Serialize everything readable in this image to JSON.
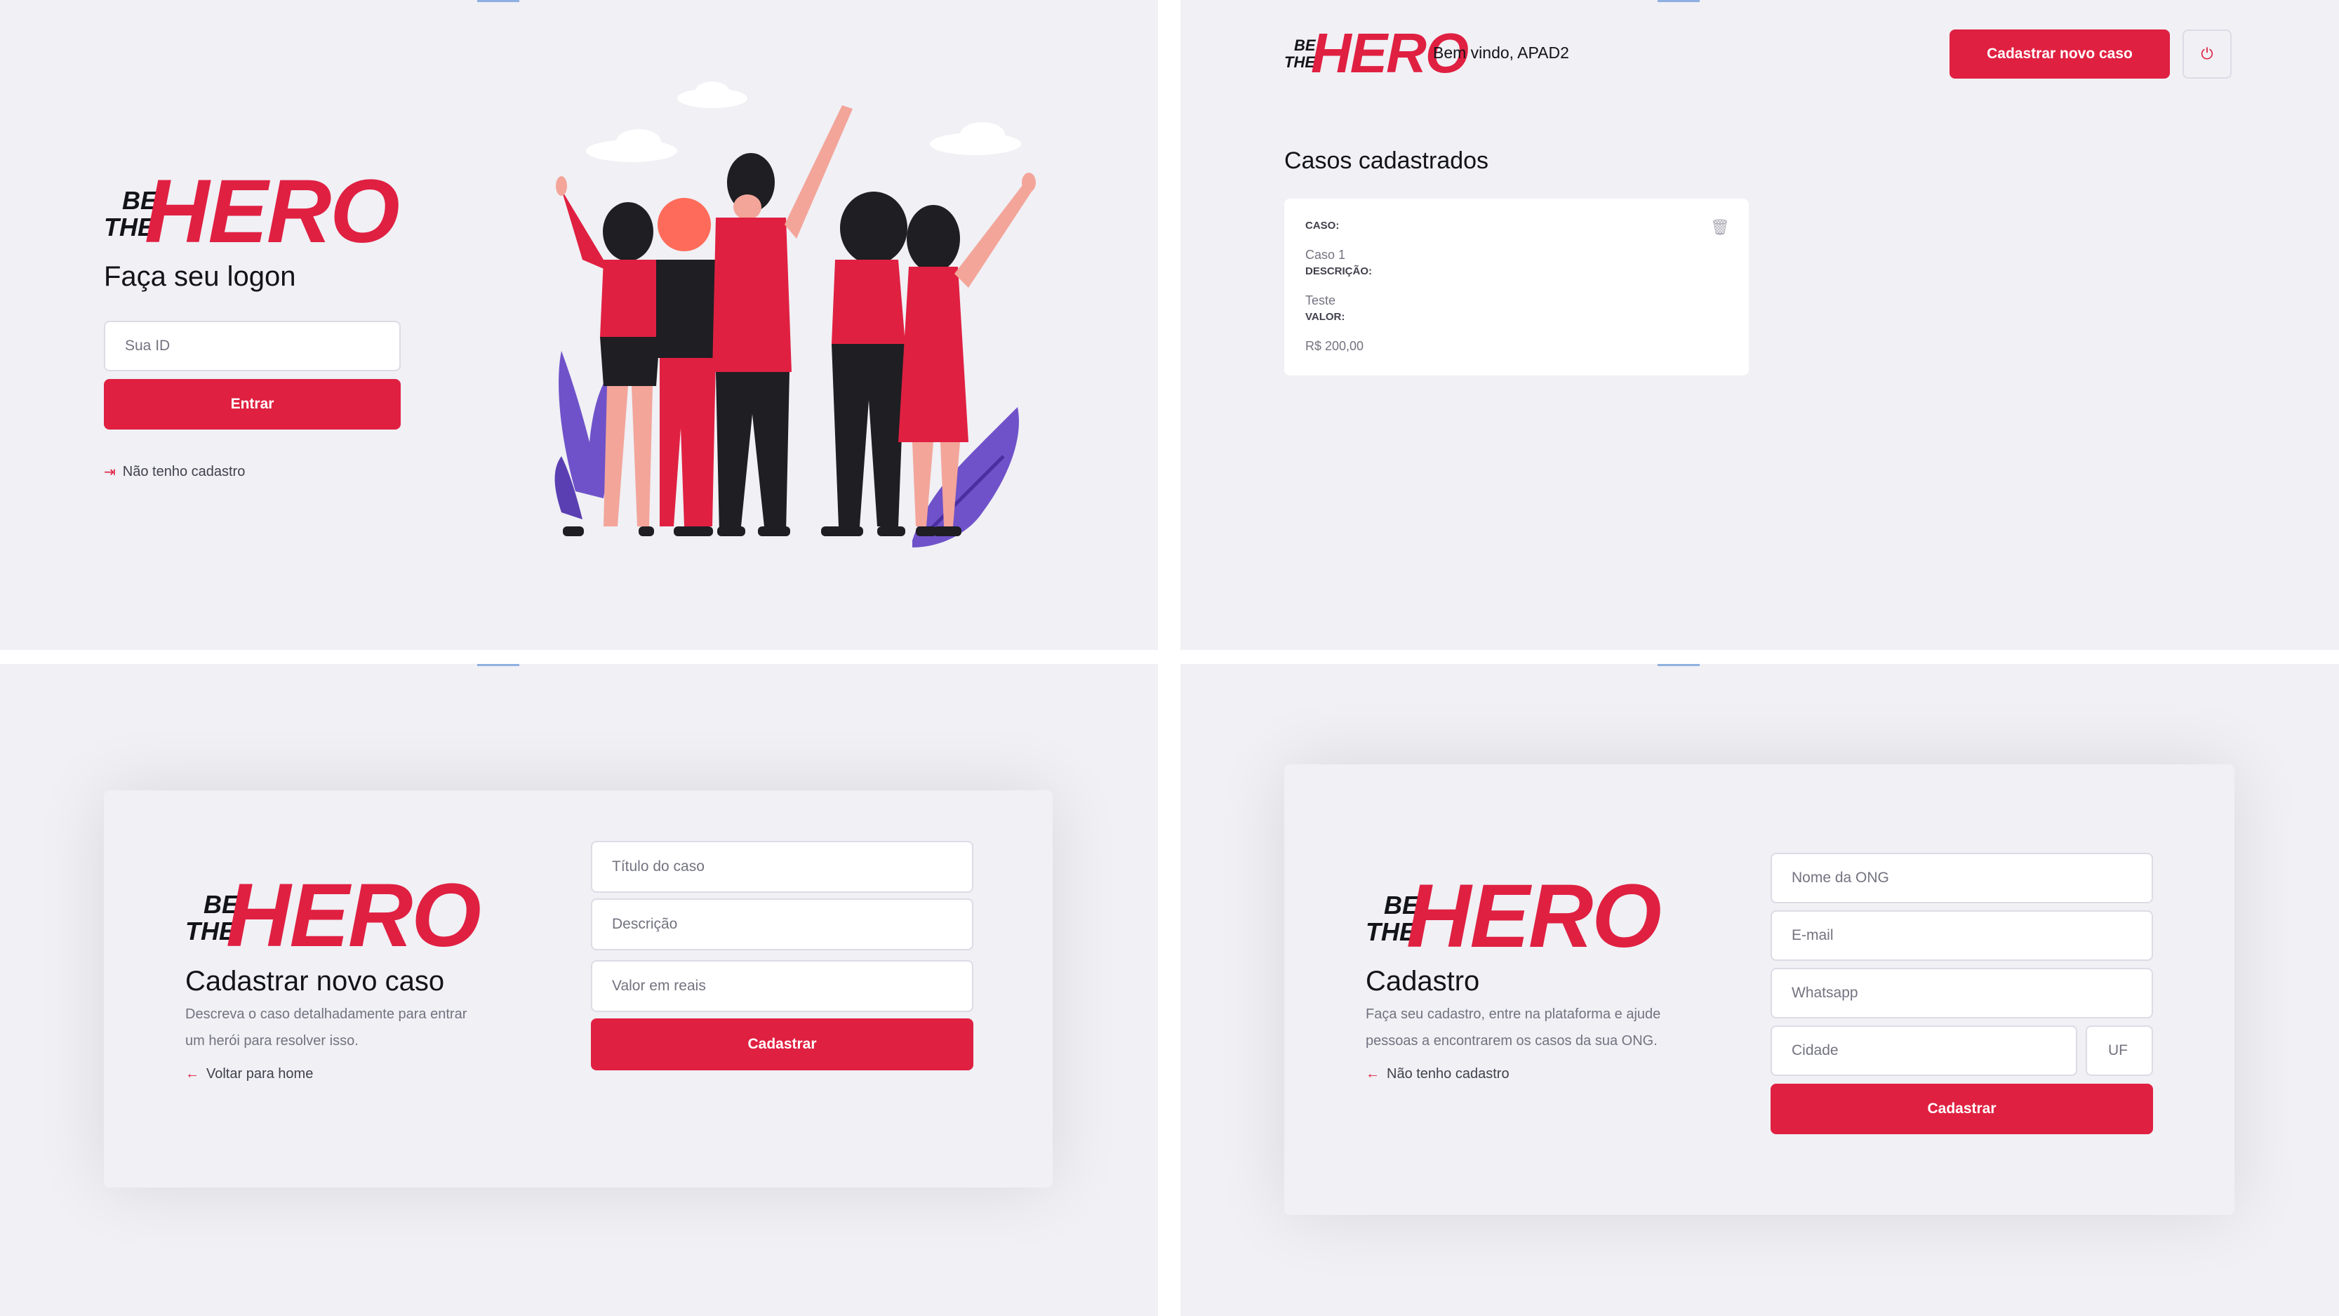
{
  "brand": {
    "be": "BE",
    "the": "THE",
    "hero": "HERO",
    "accent": "#e02041",
    "dark": "#13131a",
    "background": "#f0f0f5"
  },
  "logon": {
    "title": "Faça seu logon",
    "id_placeholder": "Sua ID",
    "submit": "Entrar",
    "register_link": "Não tenho cadastro",
    "register_icon": "log-in-icon",
    "illustration": "heroes-group-illustration"
  },
  "profile": {
    "welcome": "Bem vindo, APAD2",
    "new_case_button": "Cadastrar novo caso",
    "logout_icon": "power-icon",
    "section_title": "Casos cadastrados",
    "cases": [
      {
        "case_label": "CASO:",
        "case_value": "Caso 1",
        "description_label": "DESCRIÇÃO:",
        "description_value": "Teste",
        "value_label": "VALOR:",
        "value_value": "R$ 200,00",
        "delete_icon": "trash-icon"
      }
    ]
  },
  "new_incident": {
    "title": "Cadastrar novo caso",
    "description_line1": "Descreva o caso detalhadamente para entrar",
    "description_line2": "um herói para resolver isso.",
    "back_link": "Voltar para home",
    "back_icon": "arrow-left-icon",
    "fields": {
      "title_placeholder": "Título do caso",
      "description_placeholder": "Descrição",
      "value_placeholder": "Valor em reais"
    },
    "submit": "Cadastrar"
  },
  "register": {
    "title": "Cadastro",
    "description_line1": "Faça seu cadastro, entre na plataforma e ajude",
    "description_line2": "pessoas a encontrarem os casos da sua ONG.",
    "back_link": "Não tenho cadastro",
    "back_icon": "arrow-left-icon",
    "fields": {
      "name_placeholder": "Nome da ONG",
      "email_placeholder": "E-mail",
      "whatsapp_placeholder": "Whatsapp",
      "city_placeholder": "Cidade",
      "uf_placeholder": "UF"
    },
    "submit": "Cadastrar"
  }
}
